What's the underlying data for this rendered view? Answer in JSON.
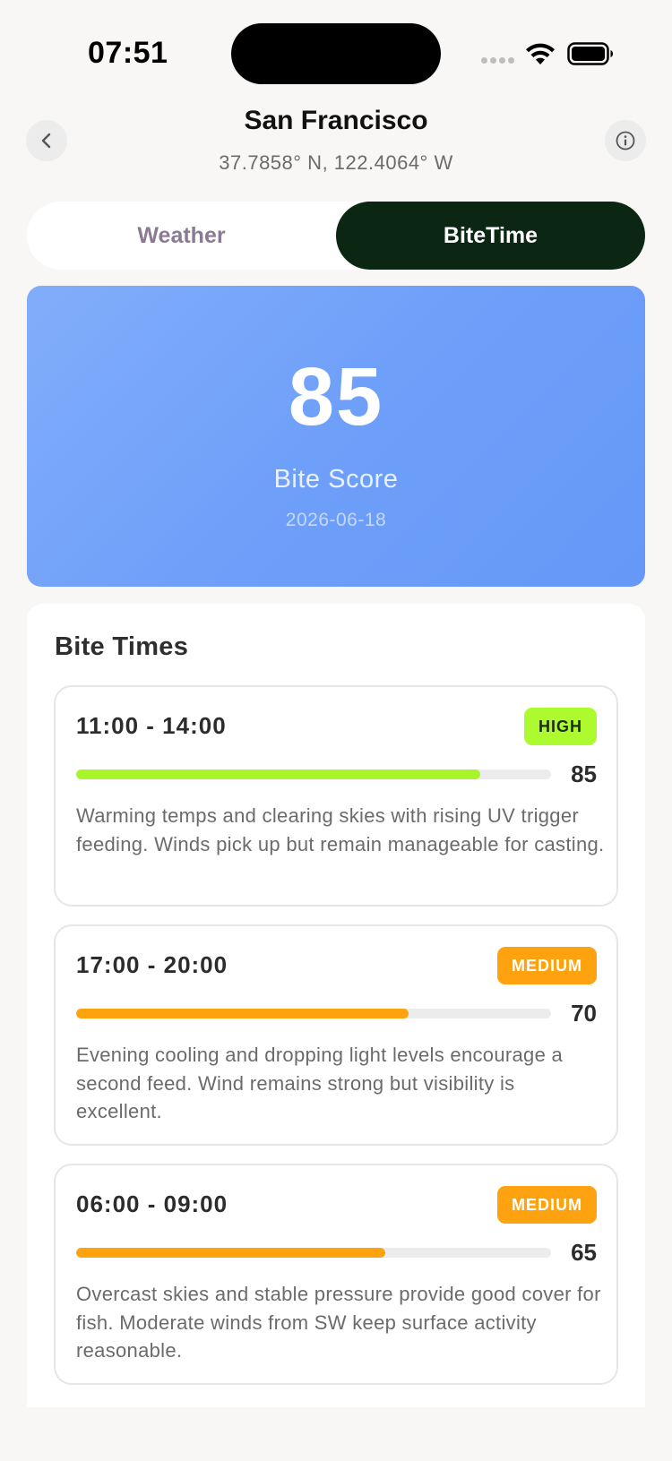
{
  "status_bar": {
    "time": "07:51"
  },
  "header": {
    "city": "San Francisco",
    "coordinates": "37.7858° N, 122.4064° W",
    "back_icon": "chevron-left-icon",
    "info_icon": "info-icon"
  },
  "tabs": [
    {
      "label": "Weather",
      "active": false
    },
    {
      "label": "BiteTime",
      "active": true
    }
  ],
  "score_card": {
    "score": "85",
    "label": "Bite Score",
    "date": "2026-06-18"
  },
  "bite_times": {
    "title": "Bite Times",
    "items": [
      {
        "time": "11:00 - 14:00",
        "level": "HIGH",
        "score": "85",
        "progress": 0.85,
        "color": "#a8f529",
        "description": "Warming temps and clearing skies with rising UV trigger feeding. Winds pick up but remain manageable for casting."
      },
      {
        "time": "17:00 - 20:00",
        "level": "MEDIUM",
        "score": "70",
        "progress": 0.7,
        "color": "#fda310",
        "description": "Evening cooling and dropping light levels encourage a second feed. Wind remains strong but visibility is excellent."
      },
      {
        "time": "06:00 - 09:00",
        "level": "MEDIUM",
        "score": "65",
        "progress": 0.65,
        "color": "#fda310",
        "description": "Overcast skies and stable pressure provide good cover for fish. Moderate winds from SW keep surface activity reasonable."
      }
    ]
  },
  "colors": {
    "background": "#f8f7f5",
    "tab_active": "#0b2613",
    "score_card_gradient_start": "#82adfa",
    "score_card_gradient_end": "#6598f8",
    "high_badge": "#adfa2f",
    "medium_badge": "#fea30f"
  }
}
